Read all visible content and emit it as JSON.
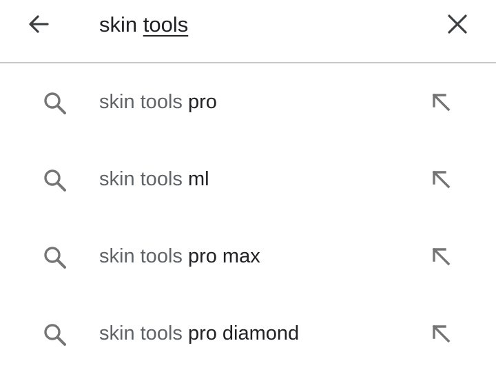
{
  "search": {
    "query_prefix": "skin ",
    "query_underlined": "tools",
    "back_icon": "arrow-back-icon",
    "clear_icon": "close-icon"
  },
  "suggestions": [
    {
      "prefix": "skin tools ",
      "suffix": "pro",
      "icon": "search-icon",
      "fill_icon": "arrow-up-left-icon"
    },
    {
      "prefix": "skin tools ",
      "suffix": "ml",
      "icon": "search-icon",
      "fill_icon": "arrow-up-left-icon"
    },
    {
      "prefix": "skin tools ",
      "suffix": "pro max",
      "icon": "search-icon",
      "fill_icon": "arrow-up-left-icon"
    },
    {
      "prefix": "skin tools ",
      "suffix": "pro diamond",
      "icon": "search-icon",
      "fill_icon": "arrow-up-left-icon"
    }
  ],
  "colors": {
    "text_primary": "#202124",
    "text_secondary": "#5f6368",
    "icon_gray": "#757575",
    "divider": "#c8c8c8"
  }
}
